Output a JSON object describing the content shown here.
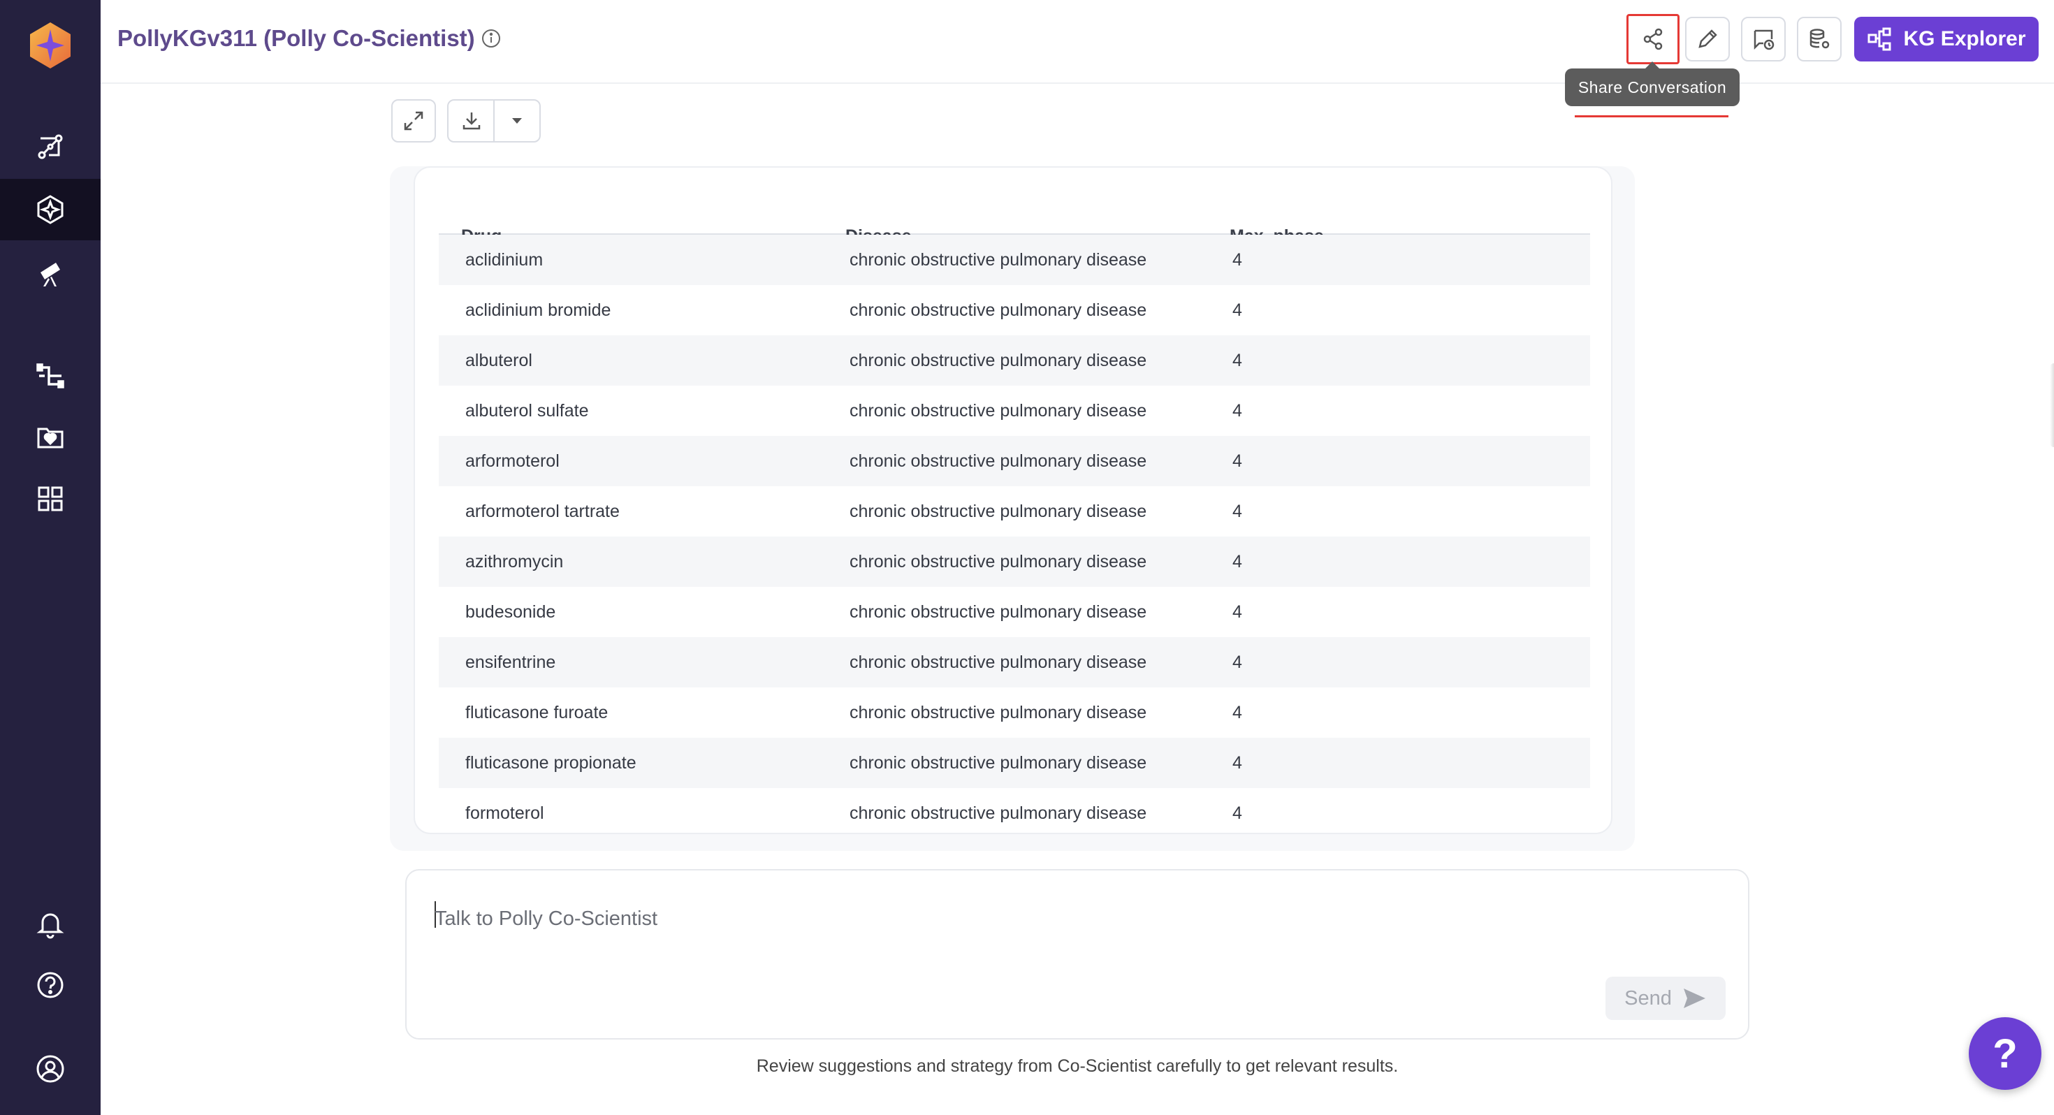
{
  "header": {
    "title": "PollyKGv311 (Polly Co-Scientist)",
    "share_tooltip": "Share Conversation",
    "kg_explorer_label": "KG Explorer"
  },
  "sidebar": {
    "items": [
      {
        "icon": "pathway-icon"
      },
      {
        "icon": "co-scientist-icon",
        "active": true
      },
      {
        "icon": "telescope-icon"
      },
      {
        "icon": "pipeline-icon"
      },
      {
        "icon": "favorites-folder-icon"
      },
      {
        "icon": "apps-grid-icon"
      },
      {
        "icon": "bell-icon"
      },
      {
        "icon": "help-icon"
      },
      {
        "icon": "user-avatar-icon"
      }
    ]
  },
  "table": {
    "columns": [
      "Drug",
      "Disease",
      "Max_phase"
    ],
    "rows": [
      [
        "aclidinium",
        "chronic obstructive pulmonary disease",
        "4"
      ],
      [
        "aclidinium bromide",
        "chronic obstructive pulmonary disease",
        "4"
      ],
      [
        "albuterol",
        "chronic obstructive pulmonary disease",
        "4"
      ],
      [
        "albuterol sulfate",
        "chronic obstructive pulmonary disease",
        "4"
      ],
      [
        "arformoterol",
        "chronic obstructive pulmonary disease",
        "4"
      ],
      [
        "arformoterol tartrate",
        "chronic obstructive pulmonary disease",
        "4"
      ],
      [
        "azithromycin",
        "chronic obstructive pulmonary disease",
        "4"
      ],
      [
        "budesonide",
        "chronic obstructive pulmonary disease",
        "4"
      ],
      [
        "ensifentrine",
        "chronic obstructive pulmonary disease",
        "4"
      ],
      [
        "fluticasone furoate",
        "chronic obstructive pulmonary disease",
        "4"
      ],
      [
        "fluticasone propionate",
        "chronic obstructive pulmonary disease",
        "4"
      ],
      [
        "formoterol",
        "chronic obstructive pulmonary disease",
        "4"
      ]
    ]
  },
  "chat": {
    "placeholder": "Talk to Polly Co-Scientist",
    "send_label": "Send",
    "footer_note": "Review suggestions and strategy from Co-Scientist carefully to get relevant results."
  },
  "help_fab": "?",
  "colors": {
    "sidebar": "#25213f",
    "accent": "#6b3fd4",
    "title": "#5e4a8c",
    "highlight": "#e53935"
  }
}
